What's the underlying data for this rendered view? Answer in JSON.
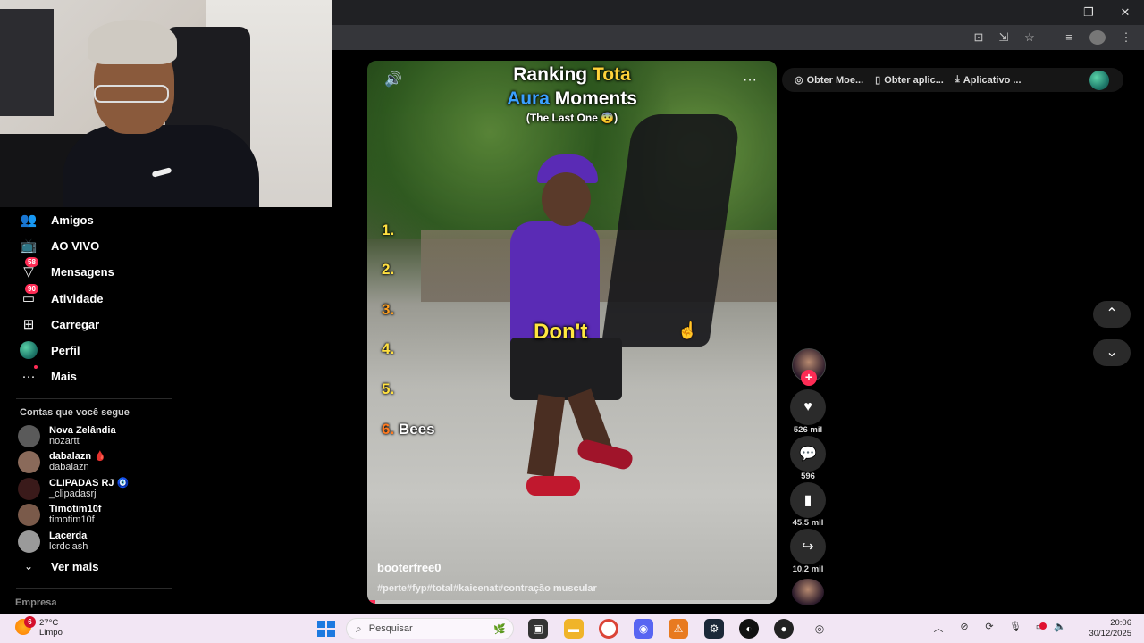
{
  "browser": {
    "window_controls": {
      "minimize": "—",
      "restore": "❐",
      "close": "✕"
    }
  },
  "sidebar": {
    "items": [
      {
        "label": "Amigos",
        "icon": "friends-icon",
        "glyph": "👥"
      },
      {
        "label": "AO VIVO",
        "icon": "live-icon",
        "glyph": "📺"
      },
      {
        "label": "Mensagens",
        "icon": "messages-icon",
        "glyph": "▽",
        "badge": "58"
      },
      {
        "label": "Atividade",
        "icon": "activity-icon",
        "glyph": "▭",
        "badge": "90"
      },
      {
        "label": "Carregar",
        "icon": "upload-icon",
        "glyph": "⊞"
      },
      {
        "label": "Perfil",
        "icon": "profile-avatar-icon",
        "glyph": ""
      },
      {
        "label": "Mais",
        "icon": "more-icon",
        "glyph": "···"
      }
    ],
    "following_title": "Contas que você segue",
    "following": [
      {
        "name": "Nova Zelândia",
        "handle": "nozartt",
        "avatar_color": "#5a5a5a"
      },
      {
        "name": "dabalazn 🩸",
        "handle": "dabalazn",
        "avatar_color": "#8a6a5a"
      },
      {
        "name": "CLIPADAS RJ 🧿",
        "handle": "_clipadasrj",
        "avatar_color": "#3a1a1a"
      },
      {
        "name": "Timotim10f",
        "handle": "timotim10f",
        "avatar_color": "#7a5a4a"
      },
      {
        "name": "Lacerda",
        "handle": "lcrdclash",
        "avatar_color": "#9a9a9a"
      }
    ],
    "see_more": "Ver mais",
    "footer": "Empresa"
  },
  "video": {
    "title_line1_a": "Ranking ",
    "title_line1_b": "Tota",
    "title_line2_a": "Aura",
    "title_line2_b": " Moments",
    "title_line3": "(The Last One 😨)",
    "ranks": [
      "1.",
      "2.",
      "3.",
      "4.",
      "5.",
      "6."
    ],
    "rank6_label": "Bees",
    "caption": "Don't",
    "author": "booterfree0",
    "hashtags": "#perte#fyp#total#kaicenat#contração muscular",
    "progress": 0.02,
    "mute_icon": "🔊",
    "more_icon": "···"
  },
  "actions": {
    "likes": "526 mil",
    "comments": "596",
    "saves": "45,5 mil",
    "shares": "10,2 mil",
    "follow": "+"
  },
  "top_pills": [
    {
      "label": "Obter Moe...",
      "icon": "coin-icon",
      "glyph": "◎"
    },
    {
      "label": "Obter aplic...",
      "icon": "phone-icon",
      "glyph": "▯"
    },
    {
      "label": "Aplicativo ...",
      "icon": "download-icon",
      "glyph": "⤓"
    }
  ],
  "nav": {
    "up": "⌃",
    "down": "⌄"
  },
  "taskbar": {
    "weather_temp": "27°C",
    "weather_desc": "Limpo",
    "weather_badge": "6",
    "search_placeholder": "Pesquisar",
    "time": "20:06",
    "date": "30/12/2025"
  }
}
